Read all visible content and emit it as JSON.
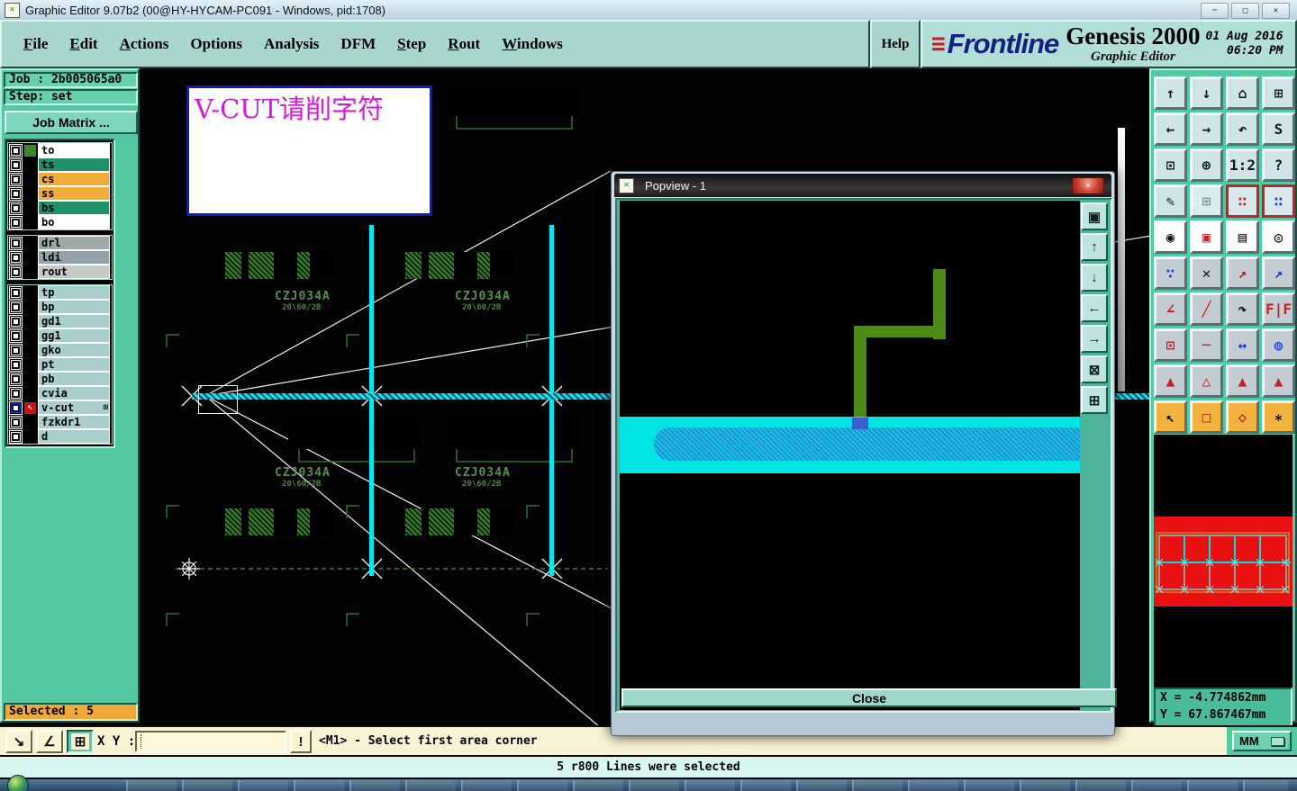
{
  "window": {
    "title": "Graphic Editor 9.07b2 (00@HY-HYCAM-PC091 - Windows, pid:1708)",
    "app_icon_glyph": "✕",
    "minimize_glyph": "─",
    "maximize_glyph": "□",
    "close_glyph": "✕"
  },
  "menu": {
    "items": [
      {
        "label": "File"
      },
      {
        "label": "Edit"
      },
      {
        "label": "Actions"
      },
      {
        "label": "Options"
      },
      {
        "label": "Analysis"
      },
      {
        "label": "DFM"
      },
      {
        "label": "Step"
      },
      {
        "label": "Rout"
      },
      {
        "label": "Windows"
      }
    ],
    "help_label": "Help"
  },
  "brand": {
    "speed_glyph": "≡",
    "logo": "Frontline",
    "product": "Genesis 2000",
    "date_line1": "01 Aug 2016",
    "date_line2": "06:20 PM",
    "subtitle": "Graphic Editor"
  },
  "sidebar": {
    "job_label": "Job : 2b005065a0",
    "step_label": "Step: set",
    "job_matrix_label": "Job Matrix ...",
    "selected_label": "Selected : 5",
    "layers_a": [
      {
        "name": "to",
        "bg": "#ffffff",
        "swatch": "#3a8a28"
      },
      {
        "name": "ts",
        "bg": "#1f9069"
      },
      {
        "name": "cs",
        "bg": "#f0ac38"
      },
      {
        "name": "ss",
        "bg": "#f0ac38"
      },
      {
        "name": "bs",
        "bg": "#1f9069"
      },
      {
        "name": "bo",
        "bg": "#ffffff"
      }
    ],
    "layers_b": [
      {
        "name": "drl",
        "bg": "#9fa8a8"
      },
      {
        "name": "ldi",
        "bg": "#93a2aa"
      },
      {
        "name": "rout",
        "bg": "#c6cac6"
      }
    ],
    "layers_c": [
      {
        "name": "tp",
        "bg": "#a9cfcd"
      },
      {
        "name": "bp",
        "bg": "#a9cfcd"
      },
      {
        "name": "gd1",
        "bg": "#a9cfcd"
      },
      {
        "name": "gg1",
        "bg": "#a9cfcd"
      },
      {
        "name": "gko",
        "bg": "#a9cfcd"
      },
      {
        "name": "pt",
        "bg": "#a9cfcd"
      },
      {
        "name": "pb",
        "bg": "#a9cfcd"
      },
      {
        "name": "cvia",
        "bg": "#a9cfcd"
      },
      {
        "name": "v-cut",
        "bg": "#a9cfcd",
        "cb": "#2233cc",
        "swatch": "#cc1111",
        "swatch_glyph": "↖",
        "tail": "⊞"
      },
      {
        "name": "fzkdr1",
        "bg": "#a9cfcd"
      },
      {
        "name": "d",
        "bg": "#a9cfcd"
      }
    ]
  },
  "canvas": {
    "note_text": "V-CUT请削字符",
    "panel_label": "CZJ034A",
    "panel_sublabel": "20\\60/2B",
    "accent_cyan": "#00e8f0",
    "trace_green": "#3f7f30"
  },
  "popview": {
    "title": "Popview - 1",
    "icon_glyph": "✕",
    "close_glyph": "✕",
    "close_label": "Close",
    "buttons": [
      {
        "n": "popview-detach-button",
        "g": "▣"
      },
      {
        "n": "popview-zoom-in-button",
        "g": "↑"
      },
      {
        "n": "popview-zoom-out-button",
        "g": "↓"
      },
      {
        "n": "popview-pan-left-button",
        "g": "←"
      },
      {
        "n": "popview-pan-right-button",
        "g": "→"
      },
      {
        "n": "popview-zoom-contract-button",
        "g": "⊠"
      },
      {
        "n": "popview-zoom-expand-button",
        "g": "⊞"
      }
    ]
  },
  "rightbar": {
    "buttons": [
      {
        "n": "zoom-in-button",
        "g": "↑",
        "bg": "#cfe4e6"
      },
      {
        "n": "zoom-out-button",
        "g": "↓",
        "bg": "#cfe4e6"
      },
      {
        "n": "home-view-button",
        "g": "⌂",
        "bg": "#cfe4e6"
      },
      {
        "n": "tile-xy-button",
        "g": "⊞",
        "bg": "#cfe4e6"
      },
      {
        "n": "pan-left-button",
        "g": "←",
        "bg": "#cfe4e6"
      },
      {
        "n": "pan-right-button",
        "g": "→",
        "bg": "#cfe4e6"
      },
      {
        "n": "previous-view-button",
        "g": "↶",
        "bg": "#cfe4e6"
      },
      {
        "n": "serpentine-button",
        "g": "S",
        "bg": "#cfe4e6"
      },
      {
        "n": "zoom-contract-button",
        "g": "⊡",
        "bg": "#cfe4e6"
      },
      {
        "n": "zoom-expand-button",
        "g": "⊕",
        "bg": "#cfe4e6"
      },
      {
        "n": "scale-1-2-button",
        "g": "1:2",
        "bg": "#cfe4e6"
      },
      {
        "n": "help-button",
        "g": "?",
        "bg": "#cfe4e6"
      },
      {
        "n": "draw-tools-button",
        "g": "✎",
        "bg": "#cfe4e6"
      },
      {
        "n": "grid-button",
        "g": "⊞",
        "bg": "#dcecee",
        "fg": "#7a9aa4"
      },
      {
        "n": "net-highlight-a-button",
        "g": "∷",
        "bg": "#d8e8ea",
        "br": "#c22222",
        "fg": "#c22222"
      },
      {
        "n": "net-highlight-b-button",
        "g": "∷",
        "bg": "#d8e8ea",
        "br": "#c22222",
        "fg": "#1a3ae0"
      },
      {
        "n": "feature-mode-button",
        "g": "◉",
        "bg": "#ffffff"
      },
      {
        "n": "symbol-mode-button",
        "g": "▣",
        "bg": "#ffffff",
        "fg": "#c22222"
      },
      {
        "n": "ruler-button",
        "g": "▤",
        "bg": "#ffffff"
      },
      {
        "n": "pad-mode-button",
        "g": "◎",
        "bg": "#ffffff"
      },
      {
        "n": "chain-select-button",
        "g": "∵",
        "bg": "#c3ccd0",
        "fg": "#1a3ae0"
      },
      {
        "n": "delete-feature-button",
        "g": "✕",
        "bg": "#c3ccd0"
      },
      {
        "n": "move-origin-button",
        "g": "↗",
        "bg": "#c3ccd0",
        "fg": "#c22222"
      },
      {
        "n": "move-feature-button",
        "g": "↗",
        "bg": "#c3ccd0",
        "fg": "#1a3ae0"
      },
      {
        "n": "measure-angle-button",
        "g": "∠",
        "bg": "#c3ccd0",
        "fg": "#c22222"
      },
      {
        "n": "slope-line-button",
        "g": "╱",
        "bg": "#c3ccd0",
        "fg": "#c22222"
      },
      {
        "n": "rotate-button",
        "g": "↷",
        "bg": "#c3ccd0"
      },
      {
        "n": "mirror-button",
        "g": "F|F",
        "bg": "#c3ccd0",
        "fg": "#c22222"
      },
      {
        "n": "copy-pad-button",
        "g": "⊡",
        "bg": "#c3ccd0",
        "fg": "#c22222"
      },
      {
        "n": "stretch-button",
        "g": "─",
        "bg": "#c3ccd0",
        "fg": "#c22222"
      },
      {
        "n": "measure-width-button",
        "g": "↔",
        "bg": "#c3ccd0",
        "fg": "#1a3ae0"
      },
      {
        "n": "surface-edit-button",
        "g": "◍",
        "bg": "#c3ccd0",
        "fg": "#1a3ae0"
      },
      {
        "n": "triangle-a-button",
        "g": "▲",
        "bg": "#c3ccd0",
        "fg": "#c22222"
      },
      {
        "n": "triangle-b-button",
        "g": "△",
        "bg": "#c3ccd0",
        "fg": "#c22222"
      },
      {
        "n": "triangle-c-button",
        "g": "▲",
        "bg": "#c3ccd0",
        "fg": "#c22222"
      },
      {
        "n": "triangle-d-button",
        "g": "▲",
        "bg": "#c3ccd0",
        "fg": "#c22222"
      },
      {
        "n": "select-single-button",
        "g": "↖",
        "bg": "#f2b23e"
      },
      {
        "n": "select-rect-button",
        "g": "□",
        "bg": "#f2b23e",
        "fg": "#c22222"
      },
      {
        "n": "select-poly-button",
        "g": "◇",
        "bg": "#f2b23e",
        "fg": "#c22222"
      },
      {
        "n": "select-net-button",
        "g": "∗",
        "bg": "#f2b23e"
      }
    ]
  },
  "coords": {
    "x_text": "X = -4.774862mm",
    "y_text": "Y = 67.867467mm"
  },
  "units": {
    "value": "MM"
  },
  "bottombar": {
    "icons": [
      {
        "n": "measure-distance-icon",
        "g": "↘"
      },
      {
        "n": "measure-angle-icon",
        "g": "∠"
      },
      {
        "n": "grid-snap-icon",
        "g": "⊞"
      }
    ],
    "xy_label": "X Y :",
    "input_value": "",
    "alert_label": "!",
    "status_text": "<M1> - Select first area corner"
  },
  "messagebar": {
    "text": "5 r800 Lines were selected"
  }
}
